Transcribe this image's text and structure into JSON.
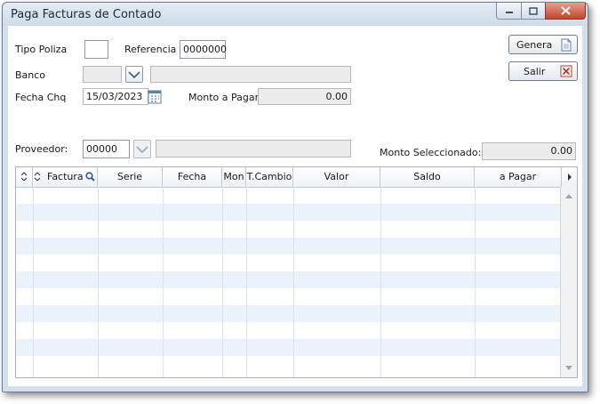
{
  "window": {
    "title": "Paga Facturas de Contado"
  },
  "form": {
    "tipo_poliza_label": "Tipo Poliza",
    "tipo_poliza_value": "",
    "referencia_label": "Referencia",
    "referencia_value": "0000000",
    "banco_label": "Banco",
    "banco_code": "",
    "banco_name": "",
    "fecha_chq_label": "Fecha Chq",
    "fecha_chq_value": "15/03/2023",
    "monto_pagar_label": "Monto a Pagar",
    "monto_pagar_value": "0.00",
    "proveedor_label": "Proveedor:",
    "proveedor_code": "00000",
    "proveedor_name": "",
    "monto_sel_label": "Monto Seleccionado:",
    "monto_sel_value": "0.00"
  },
  "buttons": {
    "genera": "Genera",
    "salir": "Salir"
  },
  "grid": {
    "columns": [
      "Factura",
      "Serie",
      "Fecha",
      "Mon",
      "T.Cambio",
      "Valor",
      "Saldo",
      "a Pagar"
    ],
    "rows": []
  },
  "icons": {
    "document": "document-icon",
    "close": "close-x-icon",
    "calendar": "calendar-icon",
    "dropdown": "dropdown-icon",
    "search": "search-icon"
  }
}
